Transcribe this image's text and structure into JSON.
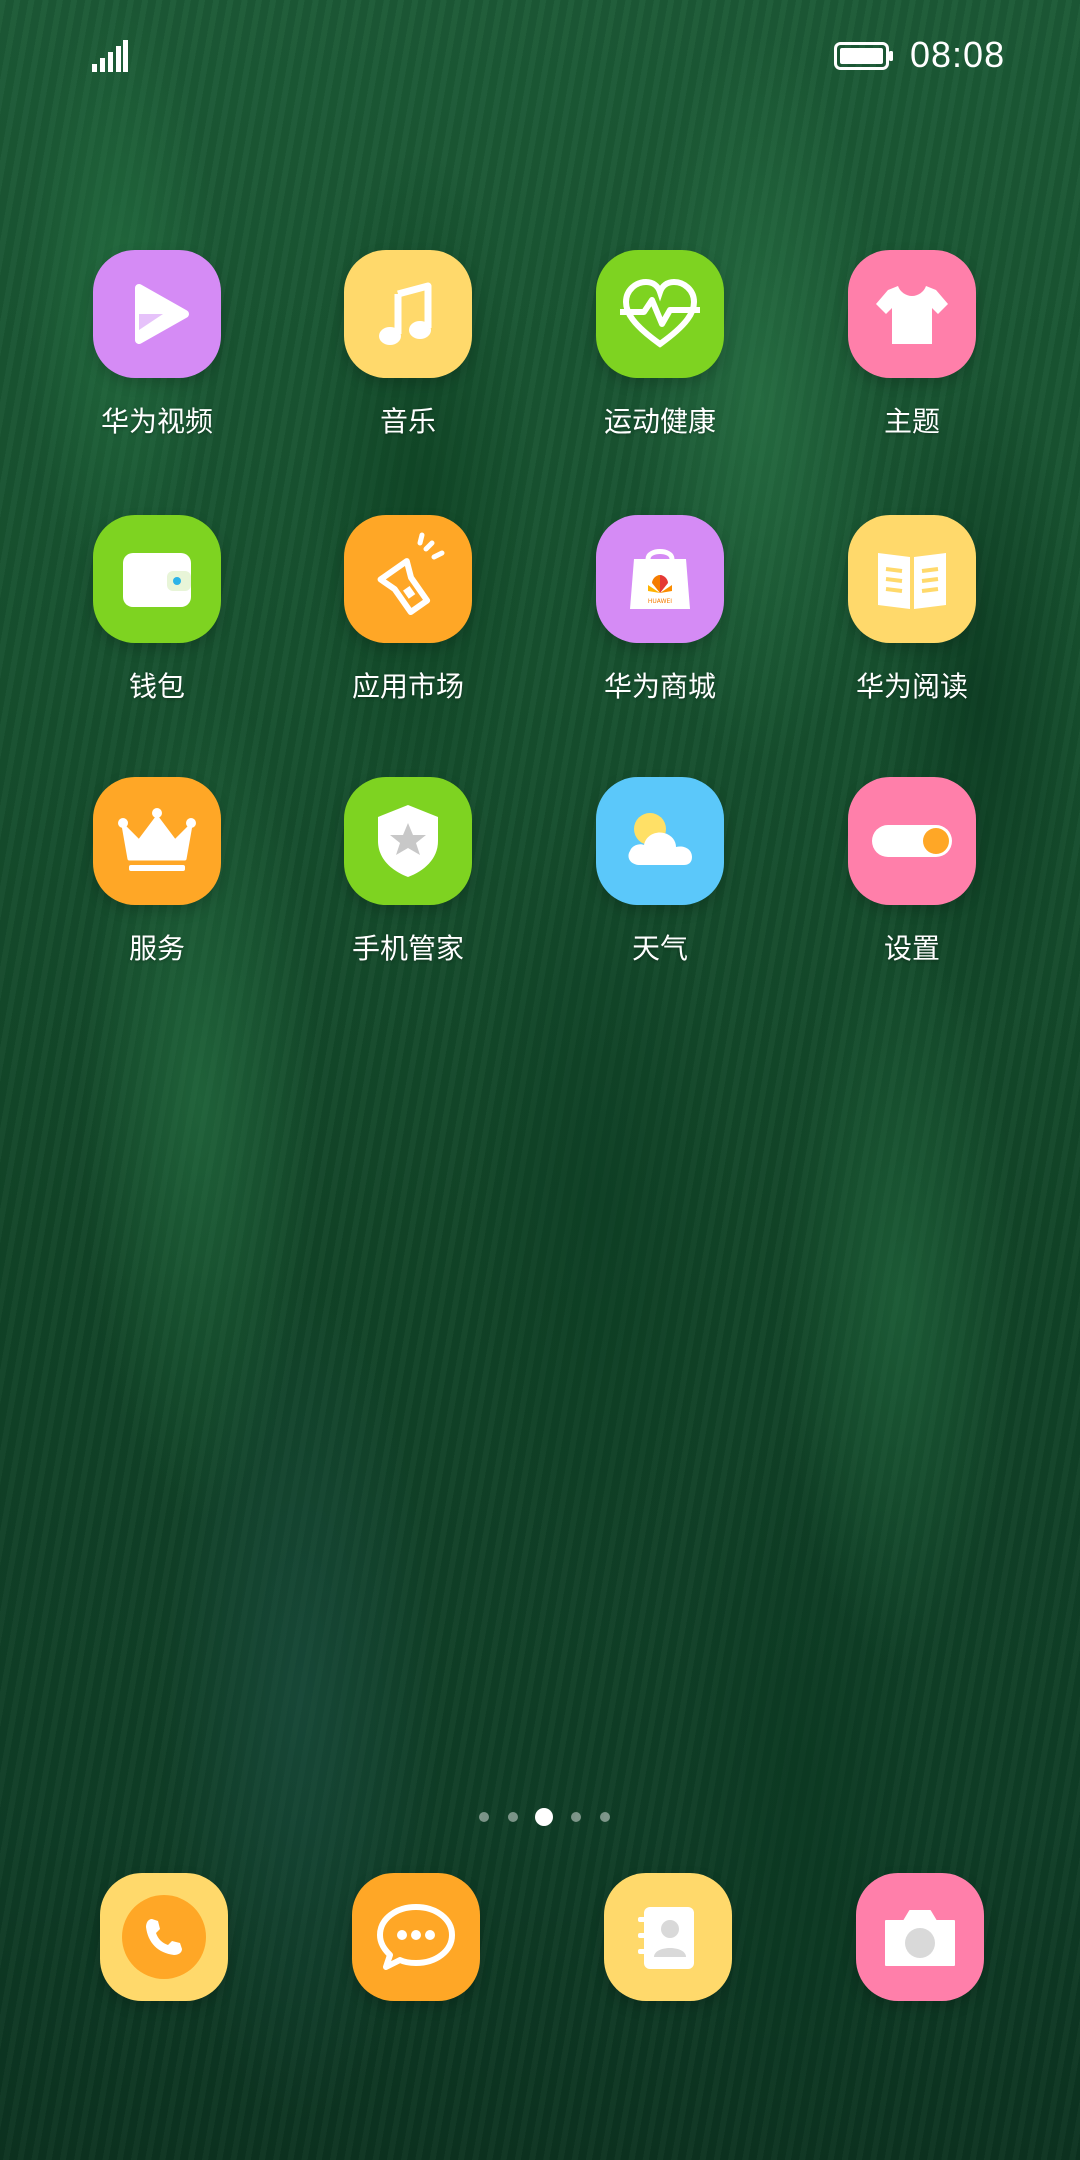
{
  "status_bar": {
    "time": "08:08",
    "signal_icon": "signal-strength-icon",
    "battery_icon": "battery-full-icon"
  },
  "apps": [
    {
      "label": "华为视频",
      "icon": "video-play-icon",
      "color": "#D58BF5"
    },
    {
      "label": "音乐",
      "icon": "music-note-icon",
      "color": "#FFD96B"
    },
    {
      "label": "运动健康",
      "icon": "heart-pulse-icon",
      "color": "#7ED321"
    },
    {
      "label": "主题",
      "icon": "tshirt-icon",
      "color": "#FF7FAA"
    },
    {
      "label": "钱包",
      "icon": "wallet-icon",
      "color": "#7ED321"
    },
    {
      "label": "应用市场",
      "icon": "flashlight-store-icon",
      "color": "#FFA726"
    },
    {
      "label": "华为商城",
      "icon": "shopping-bag-icon",
      "color": "#D58BF5"
    },
    {
      "label": "华为阅读",
      "icon": "open-book-icon",
      "color": "#FFD96B"
    },
    {
      "label": "服务",
      "icon": "crown-icon",
      "color": "#FFA726"
    },
    {
      "label": "手机管家",
      "icon": "shield-star-icon",
      "color": "#7ED321"
    },
    {
      "label": "天气",
      "icon": "sun-cloud-icon",
      "color": "#5BC8FA"
    },
    {
      "label": "设置",
      "icon": "toggle-switch-icon",
      "color": "#FF7FAA"
    }
  ],
  "page_indicator": {
    "total": 5,
    "current": 3
  },
  "dock": [
    {
      "icon": "phone-icon",
      "color": "#FFD96B"
    },
    {
      "icon": "message-bubble-icon",
      "color": "#FFA726"
    },
    {
      "icon": "contacts-icon",
      "color": "#FFD96B"
    },
    {
      "icon": "camera-icon",
      "color": "#FF7FAA"
    }
  ],
  "shopping_bag_text": "HUAWEI"
}
